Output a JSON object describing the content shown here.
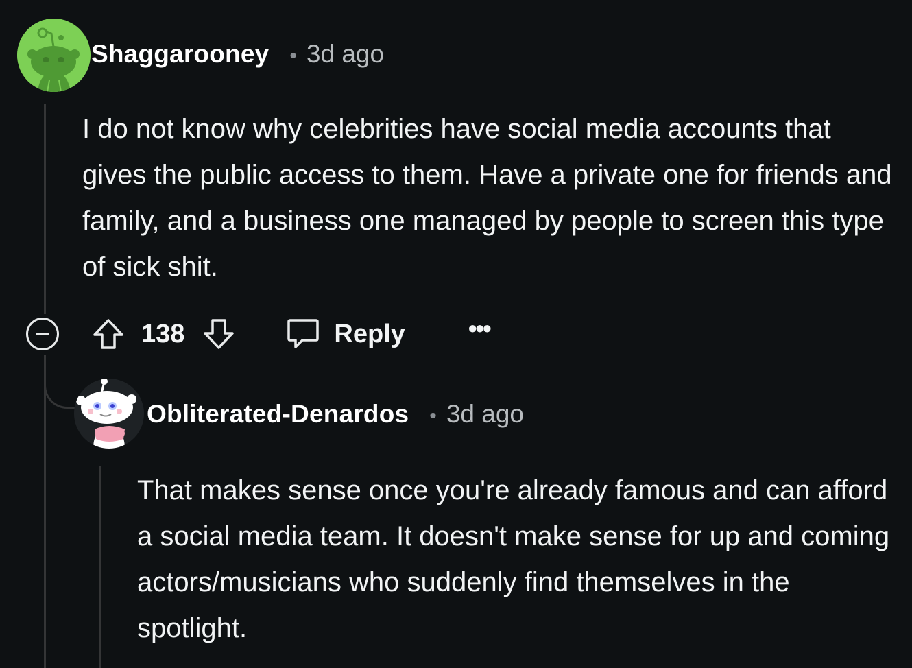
{
  "comments": [
    {
      "username": "Shaggarooney",
      "separator": "•",
      "timestamp": "3d ago",
      "body": "I do not know why celebrities have social media accounts that gives the public access to them. Have a private one for friends and family, and a business one managed by people to screen this type of sick shit.",
      "avatar_icon": "snoo-avatar-green-icon",
      "avatar_bg": "#7dd055"
    },
    {
      "username": "Obliterated-Denardos",
      "separator": "•",
      "timestamp": "3d ago",
      "body": "That makes sense once you're already famous and can afford a social media team. It doesn't make sense for up and coming actors/musicians who suddenly find themselves in the spotlight.",
      "avatar_icon": "snoo-avatar-white-icon"
    }
  ],
  "actions": {
    "score": "138",
    "reply_label": "Reply",
    "more_label": "•••",
    "collapse_icon": "collapse-minus-icon",
    "upvote_icon": "upvote-arrow-icon",
    "downvote_icon": "downvote-arrow-icon",
    "reply_icon": "speech-bubble-icon",
    "more_icon": "ellipsis-icon"
  },
  "theme": {
    "background": "#0e1113",
    "thread_line": "#343536",
    "text": "#f2f4f5",
    "meta_text": "#b8bcbf"
  }
}
